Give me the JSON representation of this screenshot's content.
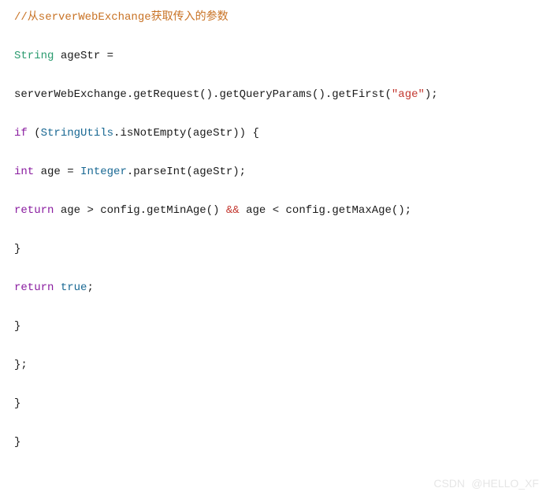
{
  "code": {
    "line1_comment": "//从serverWebExchange获取传入的参数",
    "line2_type": "String",
    "line2_var": " ageStr ",
    "line2_eq": "=",
    "line3_call": "serverWebExchange.getRequest().getQueryParams().getFirst(",
    "line3_str": "\"age\"",
    "line3_end": ");",
    "line4_if": "if",
    "line4_open": " (",
    "line4_util": "StringUtils",
    "line4_call": ".isNotEmpty(ageStr)) {",
    "line5_int": "int",
    "line5_var": " age ",
    "line5_eq": "= ",
    "line5_integer": "Integer",
    "line5_call": ".parseInt(ageStr);",
    "line6_return": "return",
    "line6_expr1": " age ",
    "line6_gt": ">",
    "line6_expr2": " config.getMinAge() ",
    "line6_amp": "&&",
    "line6_expr3": " age ",
    "line6_lt": "<",
    "line6_expr4": " config.getMaxAge();",
    "line7_brace": "}",
    "line8_return": "return",
    "line8_sp": " ",
    "line8_true": "true",
    "line8_semi": ";",
    "line9_brace": "}",
    "line10_brace_semi": "};",
    "line11_brace": "}",
    "line12_brace": "}"
  },
  "watermark": {
    "right": "@HELLO_XF",
    "left": "CSDN"
  }
}
